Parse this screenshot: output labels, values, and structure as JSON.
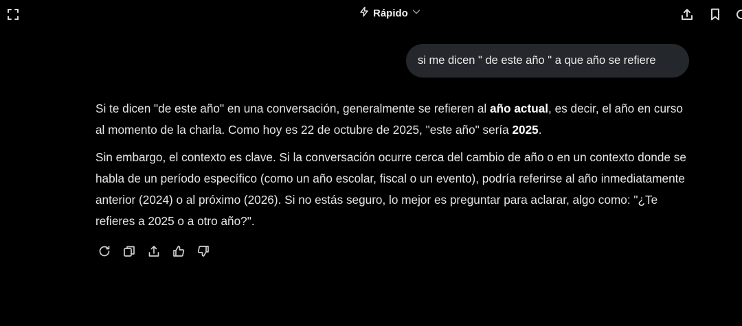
{
  "header": {
    "model_label": "Rápido",
    "icons": {
      "expand": "expand-icon",
      "model": "bolt-icon",
      "dropdown": "chevron-down-icon",
      "share": "share-upload-icon",
      "bookmark": "bookmark-icon",
      "refresh": "refresh-icon"
    }
  },
  "conversation": {
    "user_message": "si me dicen \" de este año \" a que año se refiere",
    "assistant_response": {
      "p1": {
        "t1": "Si te dicen \"de este año\" en una conversación, generalmente se refieren al ",
        "b1": "año actual",
        "t2": ", es decir, el año en curso al momento de la charla. Como hoy es 22 de octubre de 2025, \"este año\" sería ",
        "b2": "2025",
        "t3": "."
      },
      "p2": "Sin embargo, el contexto es clave. Si la conversación ocurre cerca del cambio de año o en un contexto donde se habla de un período específico (como un año escolar, fiscal o un evento), podría referirse al año inmediatamente anterior (2024) o al próximo (2026). Si no estás seguro, lo mejor es preguntar para aclarar, algo como: \"¿Te refieres a 2025 o a otro año?\"."
    }
  },
  "actions": [
    "regenerate-icon",
    "copy-icon",
    "share-icon",
    "thumbs-up-icon",
    "thumbs-down-icon"
  ],
  "colors": {
    "background": "#000000",
    "bubble": "#24272b",
    "text": "#e6e6e6",
    "icon": "#cfcfcf"
  }
}
